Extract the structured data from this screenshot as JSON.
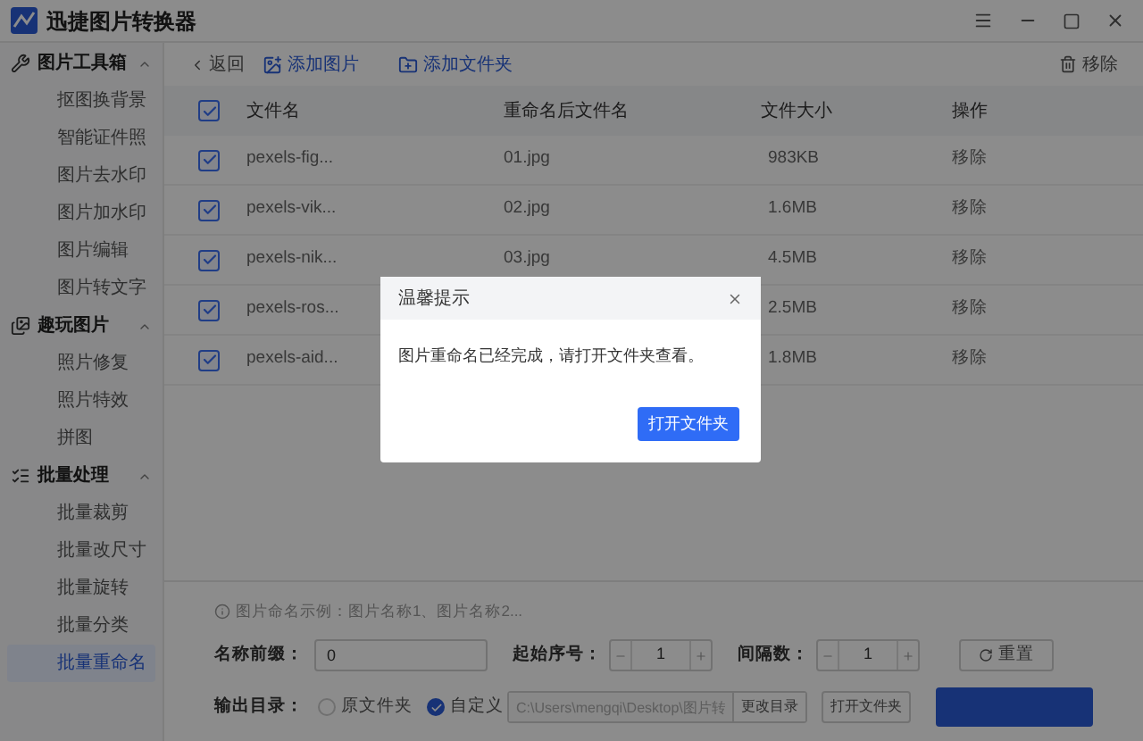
{
  "window": {
    "title": "迅捷图片转换器"
  },
  "sidebar": {
    "groups": [
      {
        "label": "图片工具箱",
        "expanded": true,
        "items": [
          {
            "label": "抠图换背景",
            "selected": false
          },
          {
            "label": "智能证件照",
            "selected": false
          },
          {
            "label": "图片去水印",
            "selected": false
          },
          {
            "label": "图片加水印",
            "selected": false
          },
          {
            "label": "图片编辑",
            "selected": false
          },
          {
            "label": "图片转文字",
            "selected": false
          }
        ]
      },
      {
        "label": "趣玩图片",
        "expanded": true,
        "items": [
          {
            "label": "照片修复",
            "selected": false
          },
          {
            "label": "照片特效",
            "selected": false
          },
          {
            "label": "拼图",
            "selected": false
          }
        ]
      },
      {
        "label": "批量处理",
        "expanded": true,
        "items": [
          {
            "label": "批量裁剪",
            "selected": false
          },
          {
            "label": "批量改尺寸",
            "selected": false
          },
          {
            "label": "批量旋转",
            "selected": false
          },
          {
            "label": "批量分类",
            "selected": false
          },
          {
            "label": "批量重命名",
            "selected": true
          }
        ]
      }
    ]
  },
  "toolbar": {
    "back": "返回",
    "add_image": "添加图片",
    "add_folder": "添加文件夹",
    "remove": "移除"
  },
  "table": {
    "all_checked": true,
    "columns": [
      "文件名",
      "重命名后文件名",
      "文件大小",
      "操作"
    ],
    "rows": [
      {
        "checked": true,
        "name": "pexels-fig...",
        "new_name": "01.jpg",
        "size": "983KB",
        "action": "移除"
      },
      {
        "checked": true,
        "name": "pexels-vik...",
        "new_name": "02.jpg",
        "size": "1.6MB",
        "action": "移除"
      },
      {
        "checked": true,
        "name": "pexels-nik...",
        "new_name": "03.jpg",
        "size": "4.5MB",
        "action": "移除"
      },
      {
        "checked": true,
        "name": "pexels-ros...",
        "size": "2.5MB",
        "action": "移除"
      },
      {
        "checked": true,
        "name": "pexels-aid...",
        "size": "1.8MB",
        "action": "移除"
      }
    ]
  },
  "options": {
    "hint": "图片命名示例：图片名称1、图片名称2...",
    "prefix_label": "名称前缀：",
    "prefix_value": "0",
    "start_label": "起始序号：",
    "start_value": "1",
    "step_label": "间隔数：",
    "step_value": "1",
    "reset": "重置",
    "output_label": "输出目录：",
    "output_choices": [
      {
        "label": "原文件夹",
        "selected": false
      },
      {
        "label": "自定义",
        "selected": true
      }
    ],
    "path": "C:\\Users\\mengqi\\Desktop\\图片转",
    "change_dir": "更改目录",
    "open_folder": "打开文件夹"
  },
  "dialog": {
    "title": "温馨提示",
    "message": "图片重命名已经完成，请打开文件夹查看。",
    "button": "打开文件夹"
  }
}
